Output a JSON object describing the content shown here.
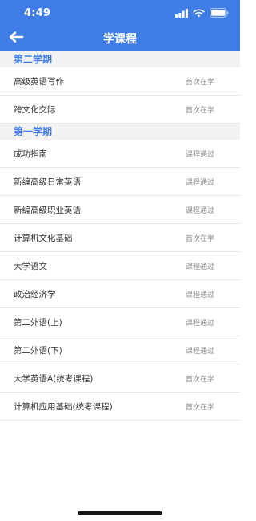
{
  "status_bar": {
    "time": "4:49",
    "icons": [
      "signal-icon",
      "wifi-icon",
      "battery-icon"
    ]
  },
  "nav": {
    "title": "学课程",
    "back_icon": "arrow-left-icon"
  },
  "colors": {
    "accent": "#3F7CE6",
    "section_bg": "#F2F2F2",
    "status_text": "#8A8A8A"
  },
  "sections": [
    {
      "title": "第二学期",
      "courses": [
        {
          "name": "高级英语写作",
          "status": "首次在学"
        },
        {
          "name": "跨文化交际",
          "status": "首次在学"
        }
      ]
    },
    {
      "title": "第一学期",
      "courses": [
        {
          "name": "成功指南",
          "status": "课程通过"
        },
        {
          "name": "新编高级日常英语",
          "status": "课程通过"
        },
        {
          "name": "新编高级职业英语",
          "status": "课程通过"
        },
        {
          "name": "计算机文化基础",
          "status": "首次在学"
        },
        {
          "name": "大学语文",
          "status": "课程通过"
        },
        {
          "name": "政治经济学",
          "status": "课程通过"
        },
        {
          "name": "第二外语(上)",
          "status": "课程通过"
        },
        {
          "name": "第二外语(下)",
          "status": "课程通过"
        },
        {
          "name": "大学英语A(统考课程)",
          "status": "首次在学"
        },
        {
          "name": "计算机应用基础(统考课程)",
          "status": "首次在学"
        }
      ]
    }
  ]
}
